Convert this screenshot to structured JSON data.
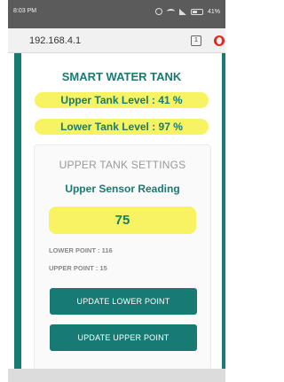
{
  "status_bar": {
    "time": "8:03 PM",
    "battery": "41%",
    "icons": [
      "alarm-icon",
      "wifi-icon",
      "signal-icon",
      "battery-icon"
    ]
  },
  "browser": {
    "url": "192.168.4.1",
    "tab_count": "1",
    "browser_icon": "opera-icon"
  },
  "app": {
    "title": "SMART WATER TANK",
    "upper_level": "Upper Tank Level : 41 %",
    "lower_level": "Lower Tank Level : 97 %"
  },
  "settings": {
    "heading": "UPPER TANK SETTINGS",
    "subheading": "Upper Sensor Reading",
    "reading": "75",
    "lower_point": "LOWER POINT : 116",
    "upper_point": "UPPER POINT : 15",
    "update_lower_label": "UPDATE LOWER POINT",
    "update_upper_label": "UPDATE UPPER POINT"
  },
  "colors": {
    "accent": "#177b73",
    "highlight": "#f8f363",
    "muted": "#999999"
  }
}
